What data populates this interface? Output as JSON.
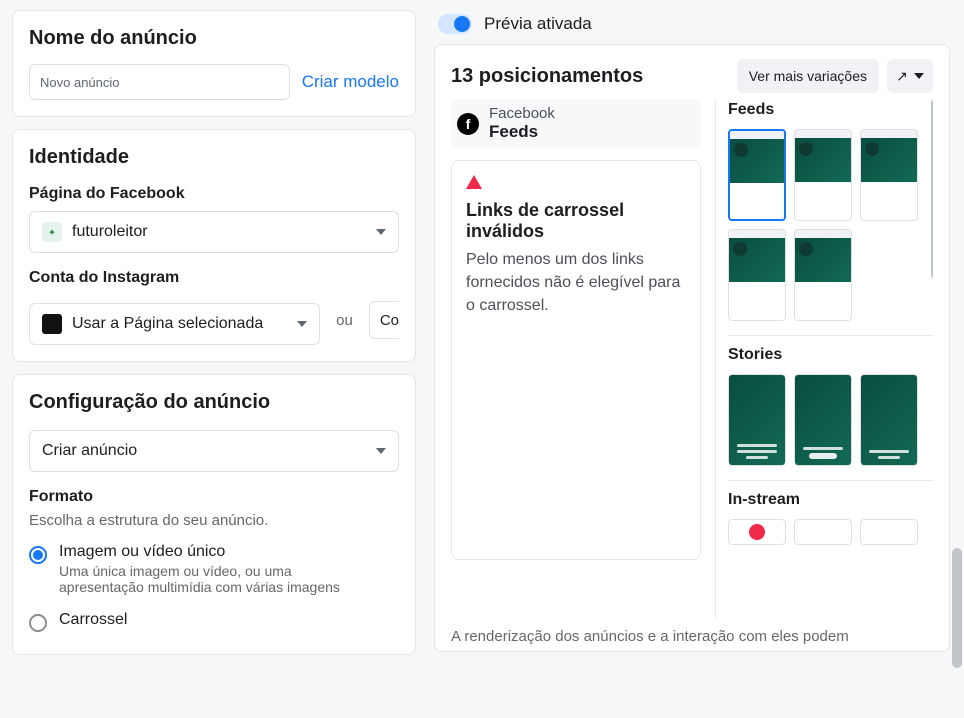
{
  "left": {
    "adName": {
      "title": "Nome do anúncio",
      "inputValue": "Novo anúncio",
      "createTemplate": "Criar modelo"
    },
    "identity": {
      "title": "Identidade",
      "fbLabel": "Página do Facebook",
      "fbPage": "futuroleitor",
      "igLabel": "Conta do Instagram",
      "igValue": "Usar a Página selecionada",
      "orLabel": "ou",
      "clippedBtn": "Co"
    },
    "config": {
      "title": "Configuração do anúncio",
      "selectValue": "Criar anúncio",
      "formatLabel": "Formato",
      "formatHelp": "Escolha a estrutura do seu anúncio.",
      "options": [
        {
          "label": "Imagem ou vídeo único",
          "desc": "Uma única imagem ou vídeo, ou uma apresentação multimídia com várias imagens",
          "selected": true
        },
        {
          "label": "Carrossel",
          "desc": "",
          "selected": false
        }
      ]
    }
  },
  "right": {
    "toggleLabel": "Prévia ativada",
    "placementsTitle": "13 posicionamentos",
    "moreVariations": "Ver mais variações",
    "platformName": "Facebook",
    "platformSection": "Feeds",
    "error": {
      "title": "Links de carrossel inválidos",
      "desc": "Pelo menos um dos links fornecidos não é elegível para o carrossel."
    },
    "groups": {
      "feeds": "Feeds",
      "stories": "Stories",
      "instream": "In-stream"
    },
    "renderNote": "A renderização dos anúncios e a interação com eles podem"
  },
  "icons": {
    "facebook": "f",
    "external": "↗"
  }
}
